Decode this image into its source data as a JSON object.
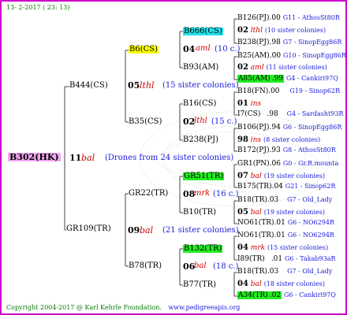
{
  "header": {
    "date": "13-  2-2017 ( 23: 13)"
  },
  "footer": {
    "copyright": "Copyright 2004-2017 @ Karl Kehrle Foundation.",
    "url": "www.pedigreeapis.org"
  },
  "root": {
    "id": "B302(HK)",
    "gen": "11",
    "mark": "bal",
    "note": "(Drones from 24 sister colonies)"
  },
  "gen1": {
    "top": {
      "id": "B444(CS)",
      "gen": "05",
      "mark": "lthl",
      "note": "(15 sister colonies)"
    },
    "bottom": {
      "id": "GR109(TR)",
      "gen": "09",
      "mark": "bal",
      "note": "(21 sister colonies)"
    }
  },
  "gen2": {
    "b6": {
      "id": "B6(CS)",
      "gen": "04",
      "mark": "aml",
      "note": "(10 c.)"
    },
    "b35": {
      "id": "B35(CS)",
      "gen": "02",
      "mark": "lthl",
      "note": "(15 c.)"
    },
    "gr22": {
      "id": "GR22(TR)",
      "gen": "08",
      "mark": "mrk",
      "note": "(16 c.)"
    },
    "b78": {
      "id": "B78(TR)",
      "gen": "06",
      "mark": "bal",
      "note": "(18 c.)"
    }
  },
  "gen3": {
    "b666": "B666(CS)",
    "b93": "B93(AM)",
    "b16": "B16(CS)",
    "b238": "B238(PJ)",
    "gr51": "GR51(TR)",
    "b10": "B10(TR)",
    "b132": "B132(TR)",
    "b77": "B77(TR)"
  },
  "gen4": [
    {
      "id": "B126(PJ)",
      "val": ".00",
      "desc": "G11 - AthosSt80R"
    },
    {
      "gen": "02",
      "mark": "lthl",
      "note": "(10 sister colonies)"
    },
    {
      "id": "B238(PJ)",
      "val": ".98",
      "desc": "G7 - SinopEgg86R"
    },
    {
      "id": "B25(AM)",
      "val": ".00",
      "desc": "G10 - SinopEgg86R"
    },
    {
      "gen": "02",
      "mark": "aml",
      "note": "(11 sister colonies)"
    },
    {
      "id": "A85(AM)",
      "val": ".99",
      "desc": "G4 - Cankiri97Q"
    },
    {
      "id": "B18(FN)",
      "val": ".00",
      "desc": "G19 - Sinop62R"
    },
    {
      "gen": "01",
      "mark": "ins",
      "note": ""
    },
    {
      "id": "I7(CS)",
      "val": ".98",
      "desc": "G4 - Sardasht93R"
    },
    {
      "id": "B106(PJ)",
      "val": ".94",
      "desc": "G6 - SinopEgg86R"
    },
    {
      "gen": "98",
      "mark": "ins",
      "note": "(8 sister colonies)"
    },
    {
      "id": "B172(PJ)",
      "val": ".93",
      "desc": "G8 - AthosSt80R"
    },
    {
      "id": "GR1(PN)",
      "val": ".06",
      "desc": "G0 - Gr.R.mounta"
    },
    {
      "gen": "07",
      "mark": "bal",
      "note": "(19 sister colonies)"
    },
    {
      "id": "B175(TR)",
      "val": ".04",
      "desc": "G21 - Sinop62R"
    },
    {
      "id": "B18(TR)",
      "val": ".03",
      "desc": "G7 - Old_Lady"
    },
    {
      "gen": "05",
      "mark": "bal",
      "note": "(19 sister colonies)"
    },
    {
      "id": "NO61(TR)",
      "val": ".01",
      "desc": "G6 - NO6294R"
    },
    {
      "id": "NO61(TR)",
      "val": ".01",
      "desc": "G6 - NO6294R"
    },
    {
      "gen": "04",
      "mark": "mrk",
      "note": "(15 sister colonies)"
    },
    {
      "id": "I89(TR)",
      "val": ".01",
      "desc": "G6 - Takab93aR"
    },
    {
      "id": "B18(TR)",
      "val": ".03",
      "desc": "G7 - Old_Lady"
    },
    {
      "gen": "04",
      "mark": "bal",
      "note": "(18 sister colonies)"
    },
    {
      "id": "A34(TR)",
      "val": ".02",
      "desc": "G6 - Cankiri97Q"
    }
  ],
  "colors": {
    "frame": "#cc00cc",
    "lines": "#444444",
    "red": "#cc0000",
    "blue": "#1a1adc",
    "green": "#0a7a0a",
    "cyan_highlight": "#22e0ea",
    "yellow_highlight": "#ffff00",
    "green_highlight": "#22ee22",
    "pink_highlight": "#f0a8f0"
  }
}
